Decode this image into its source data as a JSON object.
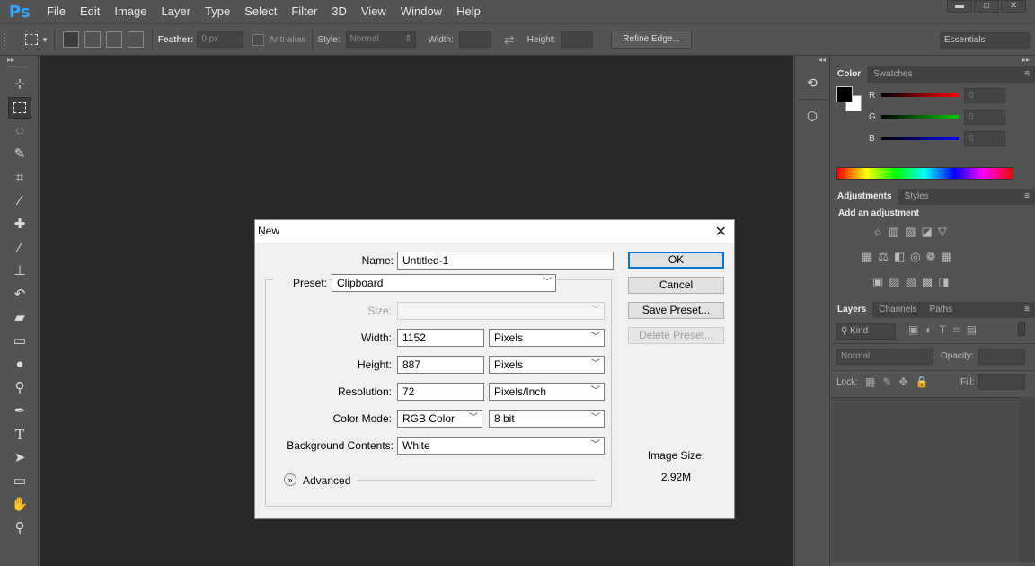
{
  "app": {
    "logo": "Ps"
  },
  "menu": [
    "File",
    "Edit",
    "Image",
    "Layer",
    "Type",
    "Select",
    "Filter",
    "3D",
    "View",
    "Window",
    "Help"
  ],
  "window_controls": {
    "minimize": "▬",
    "maximize": "□",
    "close": "✕"
  },
  "options_bar": {
    "feather_label": "Feather:",
    "feather_value": "0 px",
    "antialias_label": "Anti-alias",
    "style_label": "Style:",
    "style_value": "Normal",
    "width_label": "Width:",
    "height_label": "Height:",
    "refine_edge": "Refine Edge...",
    "workspace": "Essentials"
  },
  "toolbar": {
    "tools": [
      "move-tool",
      "marquee-tool",
      "lasso-tool",
      "quick-selection-tool",
      "crop-tool",
      "eyedropper-tool",
      "healing-brush-tool",
      "brush-tool",
      "clone-stamp-tool",
      "history-brush-tool",
      "eraser-tool",
      "gradient-tool",
      "blur-tool",
      "dodge-tool",
      "pen-tool",
      "type-tool",
      "path-selection-tool",
      "rectangle-tool",
      "hand-tool",
      "zoom-tool"
    ],
    "type_glyph": "T"
  },
  "color_panel": {
    "tabs": [
      "Color",
      "Swatches"
    ],
    "r_label": "R",
    "g_label": "G",
    "b_label": "B",
    "r_value": "0",
    "g_value": "0",
    "b_value": "0",
    "colors": {
      "r": "#ff0000",
      "g": "#00cc00",
      "b": "#0000ff"
    }
  },
  "adjustments_panel": {
    "tabs": [
      "Adjustments",
      "Styles"
    ],
    "heading": "Add an adjustment"
  },
  "layers_panel": {
    "tabs": [
      "Layers",
      "Channels",
      "Paths"
    ],
    "kind_label": "Kind",
    "blend_mode": "Normal",
    "opacity_label": "Opacity:",
    "lock_label": "Lock:",
    "fill_label": "Fill:"
  },
  "dialog": {
    "title": "New",
    "name_label": "Name:",
    "name_value": "Untitled-1",
    "preset_label": "Preset:",
    "preset_value": "Clipboard",
    "size_label": "Size:",
    "width_label": "Width:",
    "width_value": "1152",
    "width_unit": "Pixels",
    "height_label": "Height:",
    "height_value": "887",
    "height_unit": "Pixels",
    "resolution_label": "Resolution:",
    "resolution_value": "72",
    "resolution_unit": "Pixels/Inch",
    "color_mode_label": "Color Mode:",
    "color_mode_value": "RGB Color",
    "bit_depth_value": "8 bit",
    "background_label": "Background Contents:",
    "background_value": "White",
    "advanced_label": "Advanced",
    "ok": "OK",
    "cancel": "Cancel",
    "save_preset": "Save Preset...",
    "delete_preset": "Delete Preset...",
    "image_size_label": "Image Size:",
    "image_size_value": "2.92M"
  }
}
